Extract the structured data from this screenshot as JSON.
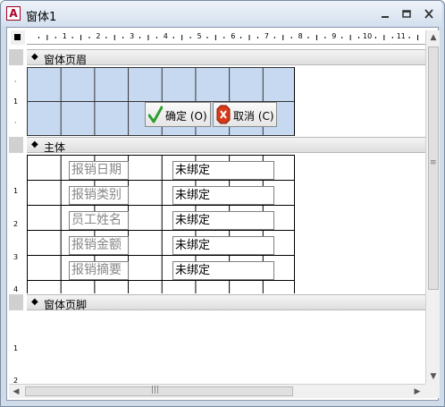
{
  "window": {
    "title": "窗体1",
    "app_icon_letter": "A"
  },
  "ruler": {
    "h_ticks": [
      "1",
      "2",
      "3",
      "4",
      "5",
      "6",
      "7",
      "8",
      "9",
      "10",
      "11"
    ],
    "v_ticks_header": [
      "1"
    ],
    "v_ticks_detail": [
      "1",
      "2",
      "3",
      "4"
    ],
    "v_ticks_footer": [
      "1",
      "2"
    ]
  },
  "sections": {
    "header": "窗体页眉",
    "detail": "主体",
    "footer": "窗体页脚"
  },
  "buttons": {
    "ok": "确定 (O)",
    "cancel": "取消 (C)"
  },
  "fields": [
    {
      "label": "报销日期",
      "value": "未绑定"
    },
    {
      "label": "报销类别",
      "value": "未绑定"
    },
    {
      "label": "员工姓名",
      "value": "未绑定"
    },
    {
      "label": "报销金额",
      "value": "未绑定"
    },
    {
      "label": "报销摘要",
      "value": "未绑定"
    }
  ],
  "scrollbars": {
    "grip": "|||",
    "vgrip": "≡"
  }
}
